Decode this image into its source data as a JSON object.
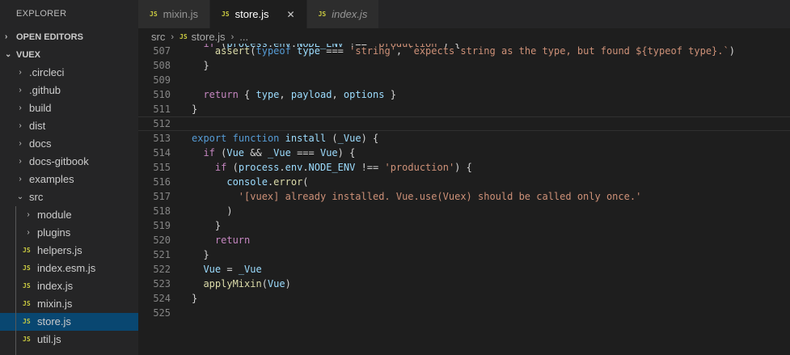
{
  "sidebar": {
    "title": "EXPLORER",
    "open_editors": "OPEN EDITORS",
    "project": "VUEX",
    "items": [
      {
        "label": ".circleci",
        "type": "folder",
        "expanded": false
      },
      {
        "label": ".github",
        "type": "folder",
        "expanded": false
      },
      {
        "label": "build",
        "type": "folder",
        "expanded": false
      },
      {
        "label": "dist",
        "type": "folder",
        "expanded": false
      },
      {
        "label": "docs",
        "type": "folder",
        "expanded": false
      },
      {
        "label": "docs-gitbook",
        "type": "folder",
        "expanded": false
      },
      {
        "label": "examples",
        "type": "folder",
        "expanded": false
      },
      {
        "label": "src",
        "type": "folder",
        "expanded": true
      },
      {
        "label": "module",
        "type": "folder",
        "expanded": false
      },
      {
        "label": "plugins",
        "type": "folder",
        "expanded": false
      },
      {
        "label": "helpers.js",
        "type": "file"
      },
      {
        "label": "index.esm.js",
        "type": "file"
      },
      {
        "label": "index.js",
        "type": "file"
      },
      {
        "label": "mixin.js",
        "type": "file"
      },
      {
        "label": "store.js",
        "type": "file",
        "selected": true
      },
      {
        "label": "util.js",
        "type": "file"
      }
    ]
  },
  "tabs": [
    {
      "label": "mixin.js",
      "active": false
    },
    {
      "label": "store.js",
      "active": true
    },
    {
      "label": "index.js",
      "active": false
    }
  ],
  "js_badge": "JS",
  "close_glyph": "✕",
  "breadcrumb": {
    "folder": "src",
    "file": "store.js",
    "more": "..."
  },
  "code": {
    "partial_line": "  if (process.env.NODE_ENV !== 'production') {",
    "lines": [
      {
        "n": "507",
        "text": "    assert(typeof type === 'string', `expects string as the type, but found ${typeof type}.`)"
      },
      {
        "n": "508",
        "text": "  }"
      },
      {
        "n": "509",
        "text": ""
      },
      {
        "n": "510",
        "text": "  return { type, payload, options }"
      },
      {
        "n": "511",
        "text": "}"
      },
      {
        "n": "512",
        "text": ""
      },
      {
        "n": "513",
        "text": "export function install (_Vue) {"
      },
      {
        "n": "514",
        "text": "  if (Vue && _Vue === Vue) {"
      },
      {
        "n": "515",
        "text": "    if (process.env.NODE_ENV !== 'production') {"
      },
      {
        "n": "516",
        "text": "      console.error("
      },
      {
        "n": "517",
        "text": "        '[vuex] already installed. Vue.use(Vuex) should be called only once.'"
      },
      {
        "n": "518",
        "text": "      )"
      },
      {
        "n": "519",
        "text": "    }"
      },
      {
        "n": "520",
        "text": "    return"
      },
      {
        "n": "521",
        "text": "  }"
      },
      {
        "n": "522",
        "text": "  Vue = _Vue"
      },
      {
        "n": "523",
        "text": "  applyMixin(Vue)"
      },
      {
        "n": "524",
        "text": "}"
      },
      {
        "n": "525",
        "text": ""
      }
    ]
  },
  "colors": {
    "keyword": "#569cd6",
    "control": "#c586c0",
    "function": "#dcdcaa",
    "variable": "#9cdcfe",
    "string": "#ce9178",
    "selection": "#094771",
    "js_badge": "#cbcb41"
  }
}
